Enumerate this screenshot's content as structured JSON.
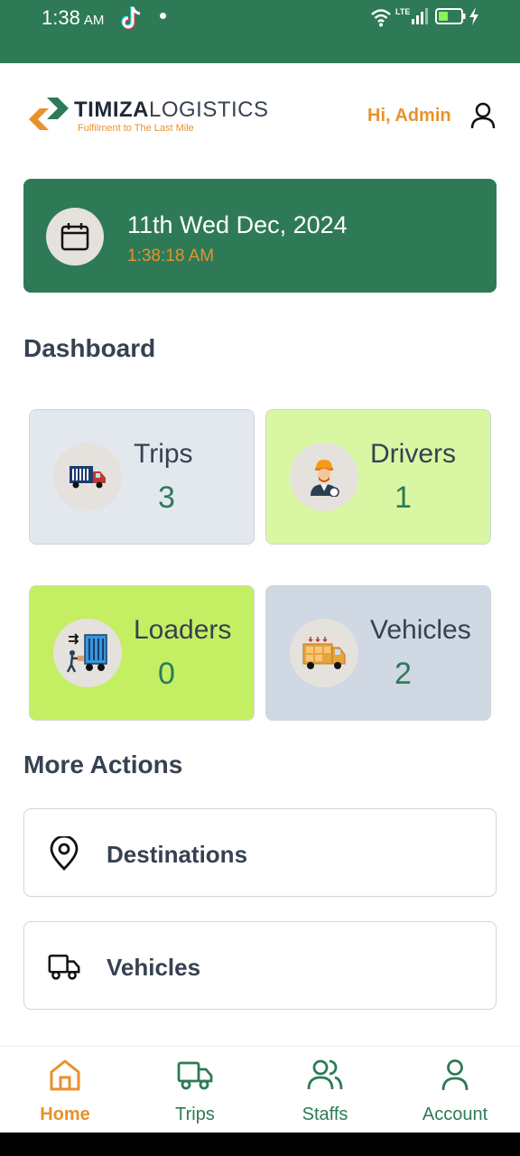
{
  "status_bar": {
    "time": "1:38",
    "ampm": "AM",
    "network": "LTE"
  },
  "header": {
    "brand_bold": "TIMIZA",
    "brand_light": "LOGISTICS",
    "tagline": "Fulfilment to The Last Mile",
    "greeting": "Hi, Admin"
  },
  "date_card": {
    "date": "11th Wed Dec, 2024",
    "time": "1:38:18 AM"
  },
  "dashboard": {
    "title": "Dashboard",
    "cards": [
      {
        "label": "Trips",
        "value": "3",
        "bg": "#e3e8ef",
        "icon": "truck-icon"
      },
      {
        "label": "Drivers",
        "value": "1",
        "bg": "#d9f7a3",
        "icon": "driver-icon"
      },
      {
        "label": "Loaders",
        "value": "0",
        "bg": "#c4ef63",
        "icon": "loader-icon"
      },
      {
        "label": "Vehicles",
        "value": "2",
        "bg": "#cfd8e3",
        "icon": "van-icon"
      }
    ]
  },
  "more_actions": {
    "title": "More Actions",
    "items": [
      {
        "label": "Destinations",
        "icon": "map-pin-icon"
      },
      {
        "label": "Vehicles",
        "icon": "truck-outline-icon"
      }
    ]
  },
  "nav": {
    "items": [
      {
        "label": "Home",
        "icon": "home-icon",
        "active": true
      },
      {
        "label": "Trips",
        "icon": "truck-outline-icon",
        "active": false
      },
      {
        "label": "Staffs",
        "icon": "users-icon",
        "active": false
      },
      {
        "label": "Account",
        "icon": "user-icon",
        "active": false
      }
    ]
  },
  "colors": {
    "primary": "#2e7a56",
    "accent": "#e8912d",
    "text": "#374151"
  }
}
